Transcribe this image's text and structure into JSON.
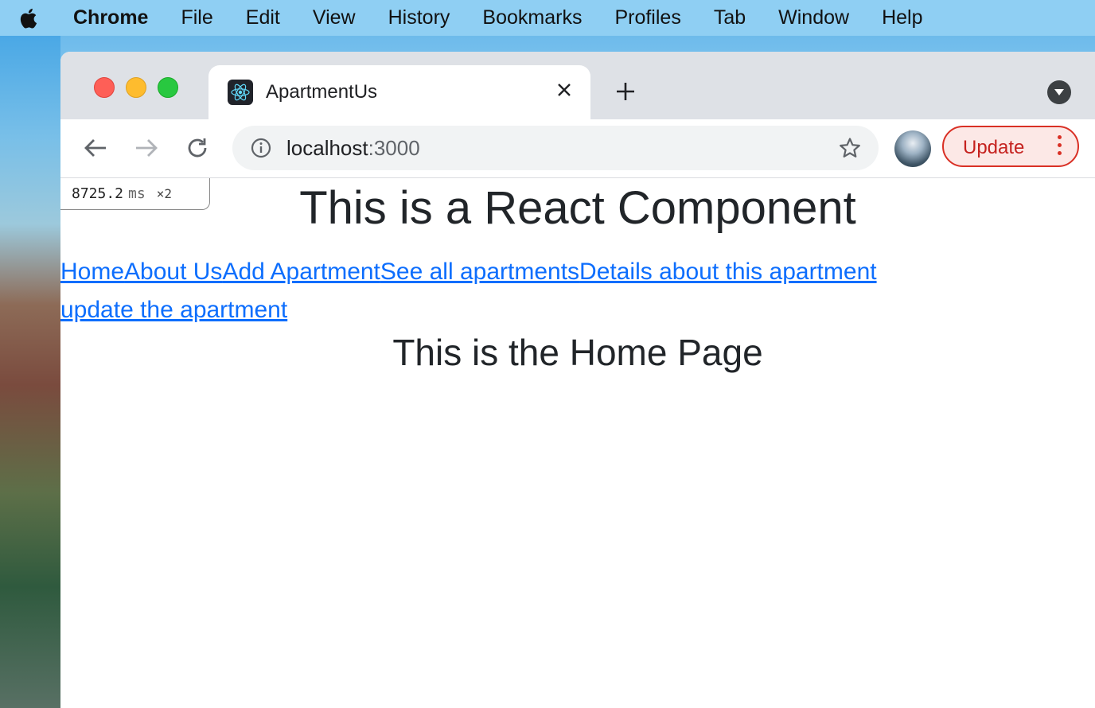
{
  "menubar": {
    "app_name": "Chrome",
    "items": [
      "File",
      "Edit",
      "View",
      "History",
      "Bookmarks",
      "Profiles",
      "Tab",
      "Window",
      "Help"
    ]
  },
  "browser": {
    "tab_title": "ApartmentUs",
    "url_host": "localhost",
    "url_port": ":3000",
    "update_label": "Update"
  },
  "page": {
    "perf_value": "8725.2",
    "perf_unit": "ms",
    "perf_multiplier": "×2",
    "main_title": "This is a React Component",
    "nav_links": [
      "Home",
      "About Us",
      "Add Apartment",
      "See all apartments",
      "Details about this apartment",
      "update the apartment"
    ],
    "home_title": "This is the Home Page"
  },
  "colors": {
    "link": "#0d6efd",
    "update_accent": "#d93025",
    "menubar_bg": "#8fcff3"
  }
}
